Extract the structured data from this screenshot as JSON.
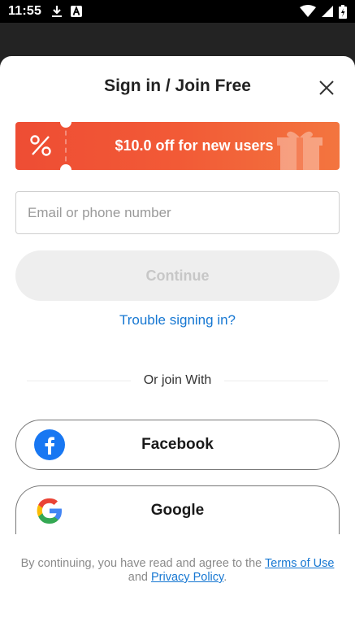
{
  "status_bar": {
    "time": "11:55",
    "left_icons": [
      "download-icon",
      "a-letter-icon"
    ],
    "right_icons": [
      "wifi-icon",
      "cellular-signal-icon",
      "battery-icon"
    ]
  },
  "modal": {
    "title": "Sign in / Join Free",
    "close_icon": "close-icon"
  },
  "promo": {
    "text": "$10.0 off for new users",
    "icon": "percent-icon",
    "decoration": "gift-icon",
    "colors": {
      "start": "#ee4d34",
      "end": "#f3753f"
    }
  },
  "form": {
    "email_placeholder": "Email or phone number",
    "email_value": "",
    "continue_label": "Continue",
    "trouble_label": "Trouble signing in?"
  },
  "social": {
    "divider_text": "Or join With",
    "facebook_label": "Facebook",
    "google_label": "Google"
  },
  "legal": {
    "prefix": "By continuing, you have read and agree to the",
    "terms_label": "Terms of Use",
    "and": "and",
    "privacy_label": "Privacy Policy",
    "suffix": "."
  },
  "colors": {
    "link": "#1677d2",
    "facebook": "#1877f2"
  }
}
